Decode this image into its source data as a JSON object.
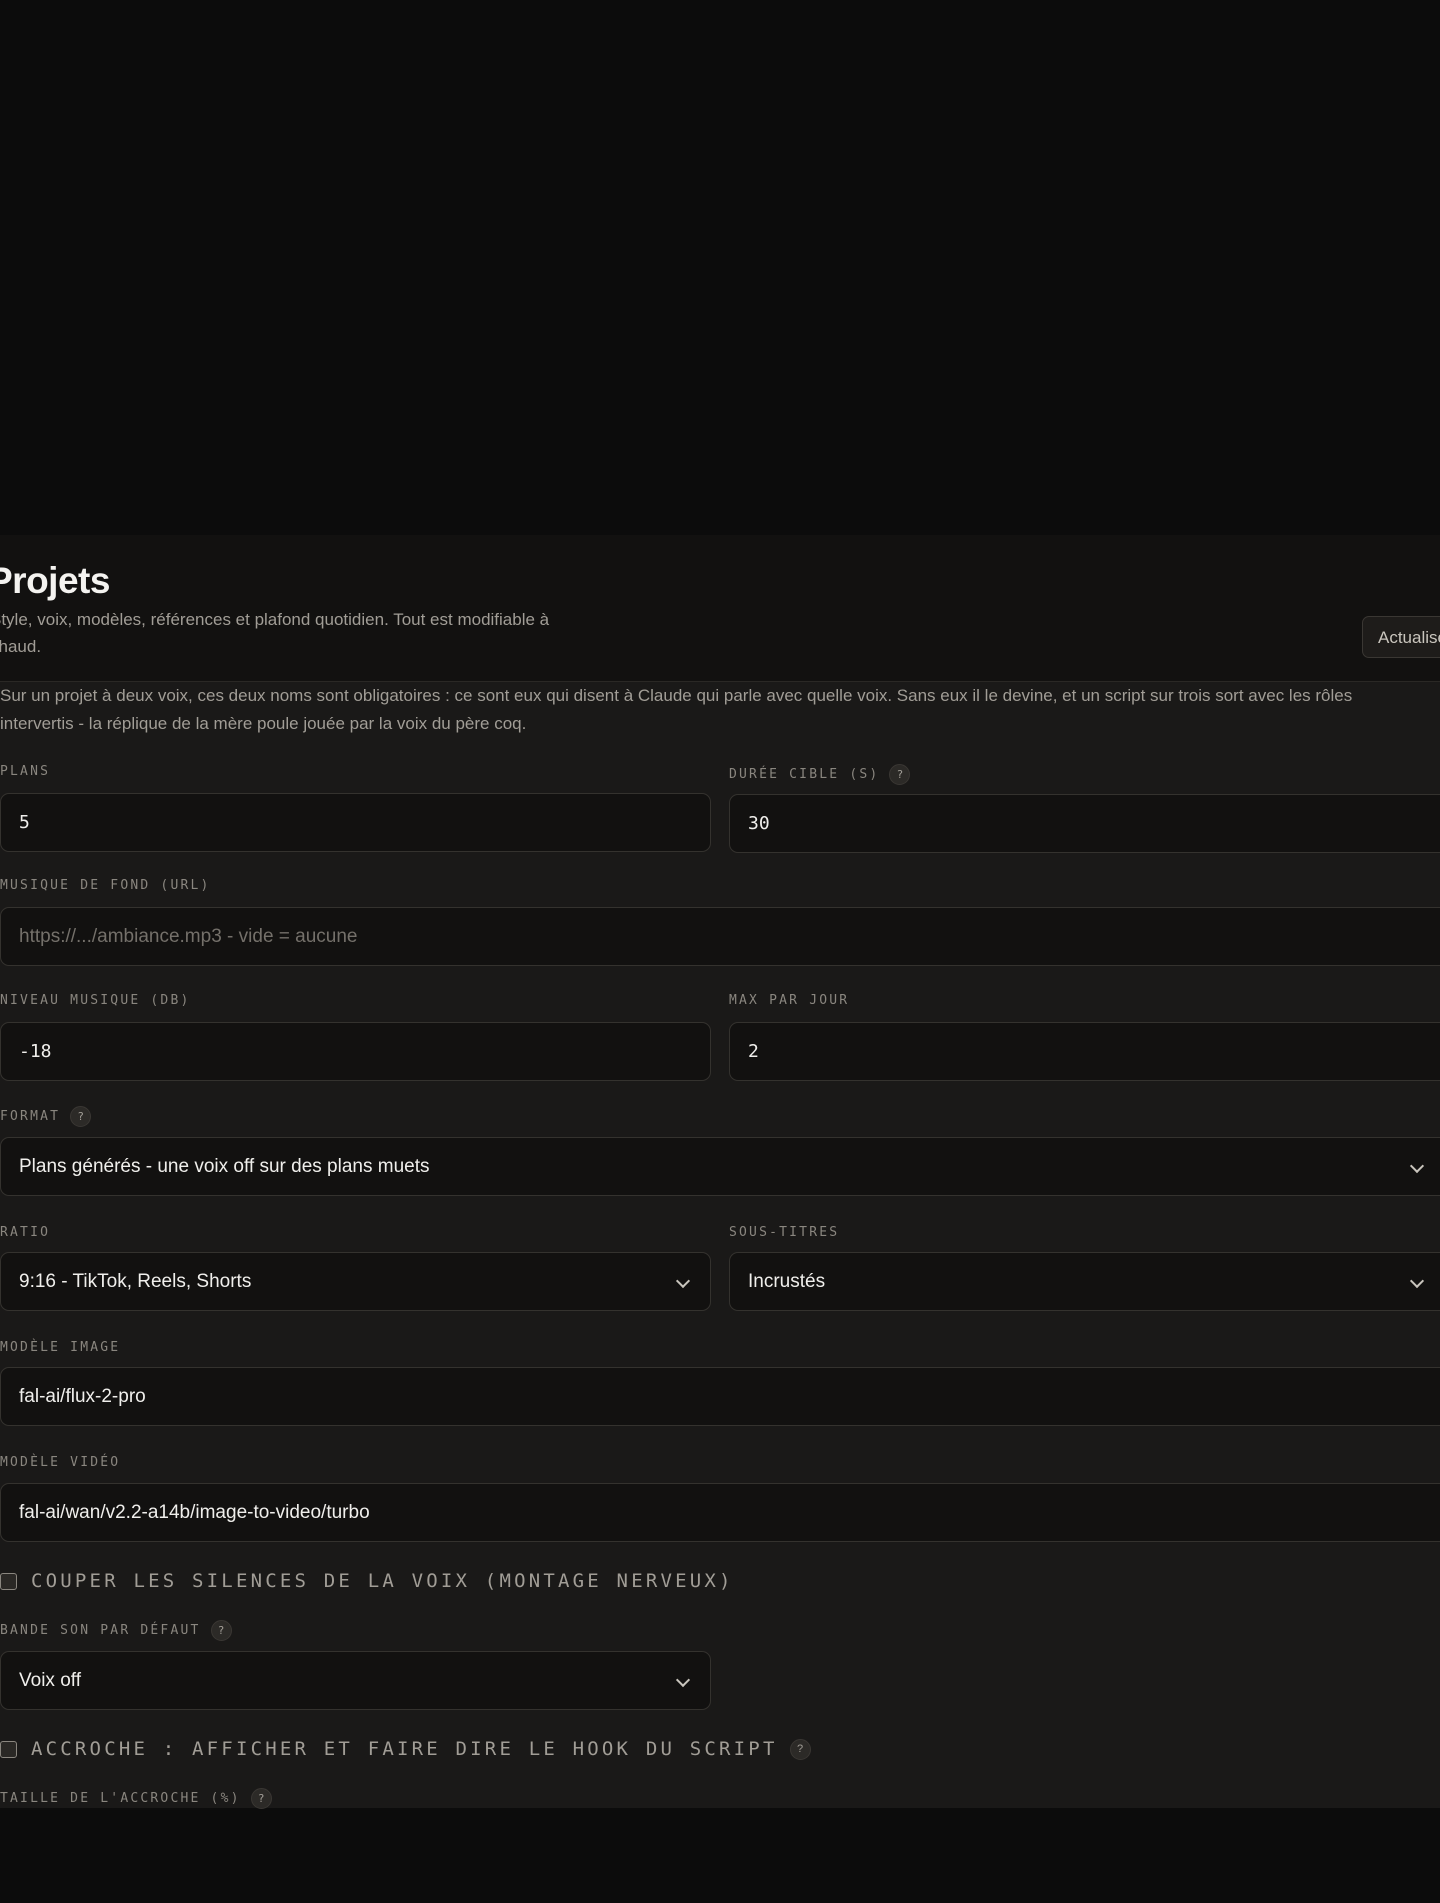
{
  "header": {
    "title": "Projets",
    "subtitle": "Style, voix, modèles, références et plafond quotidien. Tout est modifiable à chaud.",
    "refresh_label": "Actualiser"
  },
  "note": "Sur un projet à deux voix, ces deux noms sont obligatoires : ce sont eux qui disent à Claude qui parle avec quelle voix. Sans eux il le devine, et un script sur trois sort avec les rôles intervertis - la réplique de la mère poule jouée par la voix du père coq.",
  "help_glyph": "?",
  "form": {
    "plans": {
      "label": "Plans",
      "value": "5"
    },
    "duree": {
      "label": "Durée cible (s)",
      "value": "30"
    },
    "musique": {
      "label": "Musique de fond (URL)",
      "placeholder": "https://.../ambiance.mp3 - vide = aucune"
    },
    "niveau": {
      "label": "Niveau musique (dB)",
      "value": "-18"
    },
    "max": {
      "label": "Max par jour",
      "value": "2"
    },
    "format": {
      "label": "Format",
      "value": "Plans générés - une voix off sur des plans muets"
    },
    "ratio": {
      "label": "Ratio",
      "value": "9:16 - TikTok, Reels, Shorts"
    },
    "soustitres": {
      "label": "Sous-titres",
      "value": "Incrustés"
    },
    "modele_image": {
      "label": "Modèle image",
      "value": "fal-ai/flux-2-pro"
    },
    "modele_video": {
      "label": "Modèle vidéo",
      "value": "fal-ai/wan/v2.2-a14b/image-to-video/turbo"
    },
    "couper": {
      "label": "Couper les silences de la voix (montage nerveux)",
      "checked": false
    },
    "bande_son": {
      "label": "Bande son par défaut",
      "value": "Voix off"
    },
    "accroche": {
      "label": "Accroche : afficher et faire dire le hook du script",
      "checked": false
    },
    "taille_accroche": {
      "label": "Taille de l'accroche (%)"
    }
  }
}
